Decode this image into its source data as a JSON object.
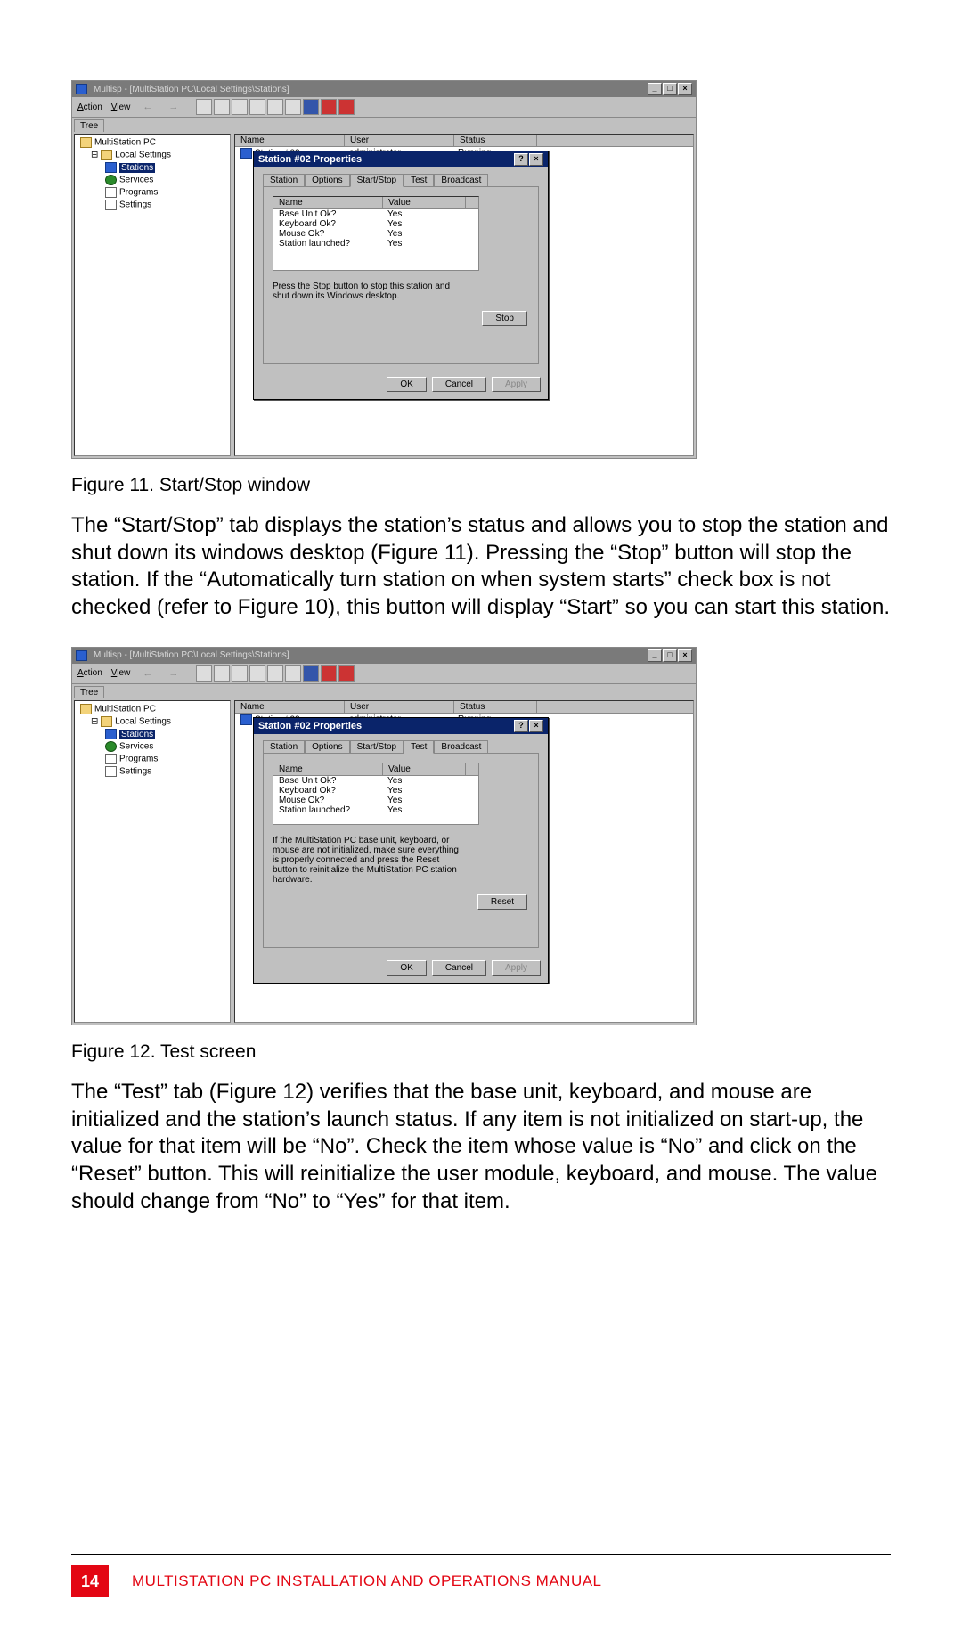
{
  "fig1": {
    "window_title": "Multisp - [MultiStation PC\\Local Settings\\Stations]",
    "menu": {
      "action": "Action",
      "view": "View"
    },
    "tree_tab": "Tree",
    "tree": {
      "root": "MultiStation PC",
      "local": "Local Settings",
      "stations": "Stations",
      "services": "Services",
      "programs": "Programs",
      "settings": "Settings"
    },
    "list": {
      "h_name": "Name",
      "h_user": "User",
      "h_status": "Status",
      "r_name": "Station #02",
      "r_user": "administrator",
      "r_status": "Running"
    },
    "dialog": {
      "title": "Station #02 Properties",
      "tabs": {
        "station": "Station",
        "options": "Options",
        "startstop": "Start/Stop",
        "test": "Test",
        "broadcast": "Broadcast"
      },
      "ph_name": "Name",
      "ph_value": "Value",
      "rows": {
        "base": "Base Unit Ok?",
        "kbd": "Keyboard Ok?",
        "mouse": "Mouse Ok?",
        "launch": "Station launched?",
        "yes": "Yes"
      },
      "hint": "Press the Stop button to stop this station and shut down its Windows desktop.",
      "stop": "Stop",
      "ok": "OK",
      "cancel": "Cancel",
      "apply": "Apply"
    }
  },
  "fig2": {
    "dialog": {
      "hint": "If the MultiStation PC base unit, keyboard, or mouse are not initialized, make sure everything is properly connected and press the Reset button to reinitialize the MultiStation PC station hardware.",
      "reset": "Reset"
    }
  },
  "captions": {
    "c1": "Figure 11. Start/Stop window",
    "c2": "Figure 12. Test screen"
  },
  "paras": {
    "p1": "The “Start/Stop” tab displays the station’s status and allows you to stop the station and shut down its windows desktop (Figure 11). Pressing the “Stop” button will stop the station.  If the “Automatically turn station on when system starts” check box is not checked (refer to Figure 10), this button will display “Start” so you can start this station.",
    "p2": "The “Test” tab (Figure 12) verifies that the base unit, keyboard, and mouse are initialized and the station’s launch status.  If any item is not initialized on start-up, the value for that item will be “No”.  Check the item whose value is “No” and click on the “Reset” button.  This will reinitialize the user module, keyboard, and mouse.  The value should change from “No” to “Yes” for that item."
  },
  "footer": {
    "page": "14",
    "title": "MULTISTATION PC INSTALLATION AND OPERATIONS MANUAL"
  }
}
